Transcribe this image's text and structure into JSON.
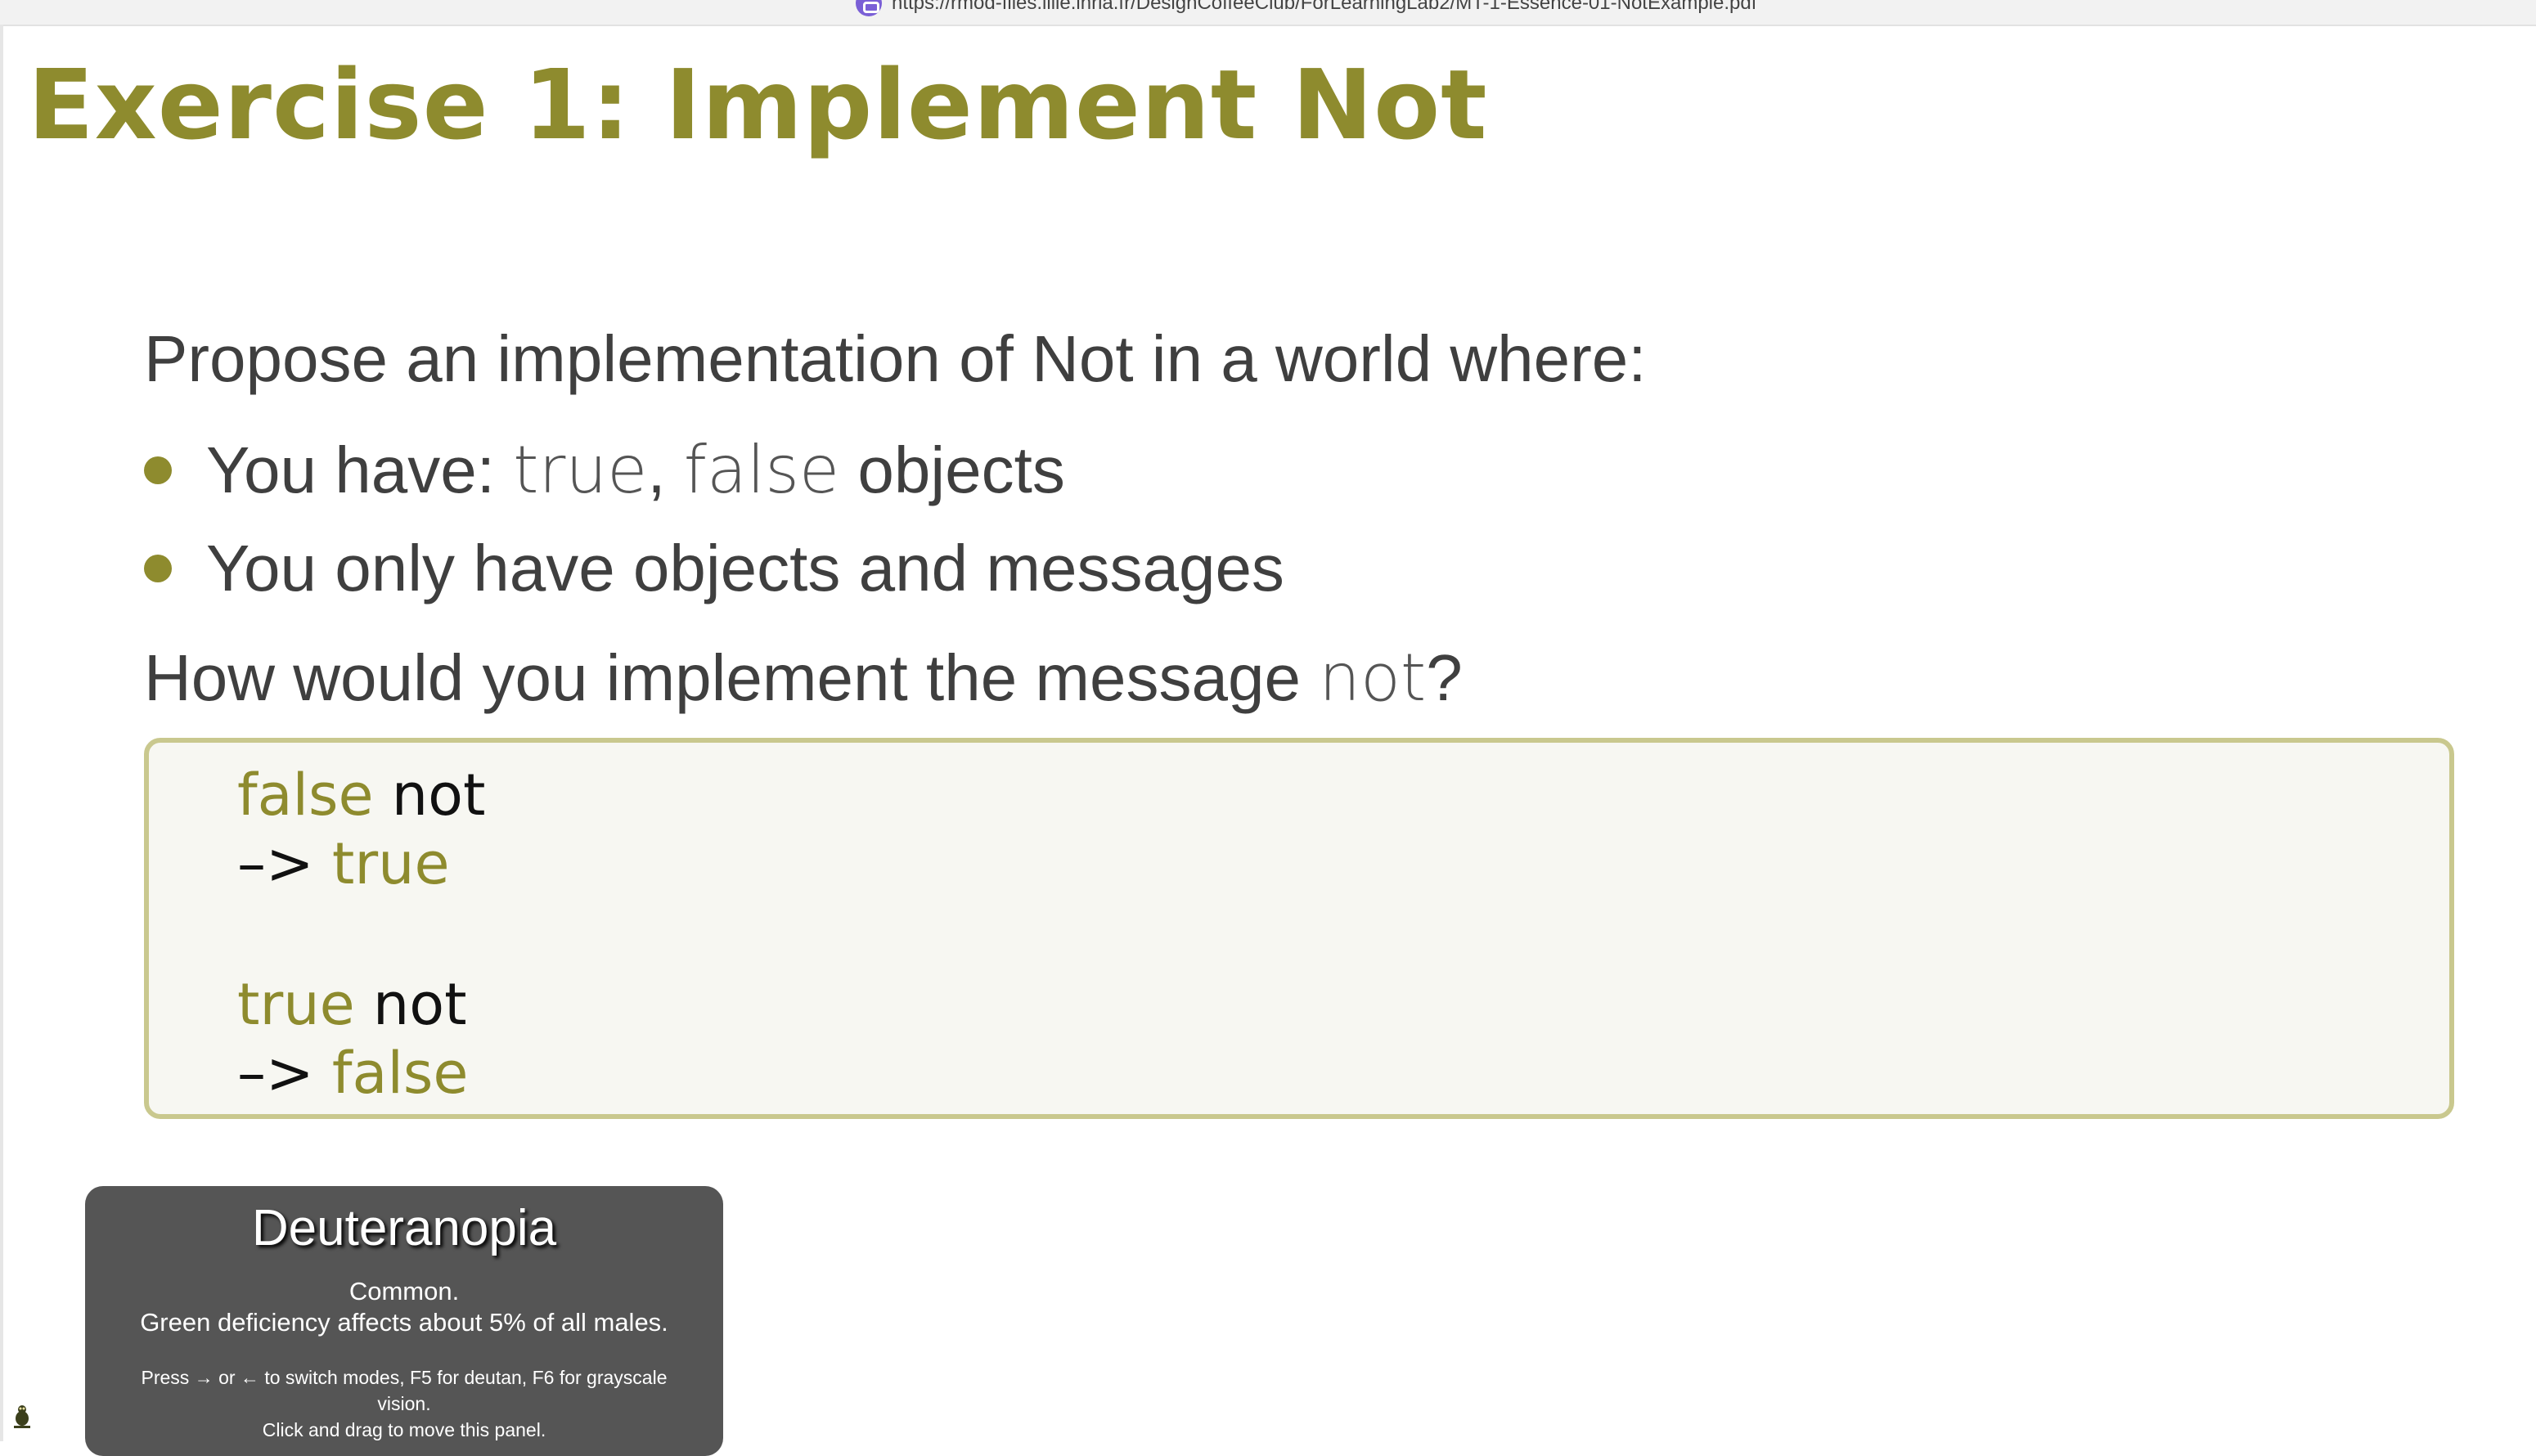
{
  "browser": {
    "url": "https://rmod-files.lille.inria.fr/DesignCoffeeClub/ForLearningLab2/MT-1-Essence-01-NotExample.pdf"
  },
  "slide": {
    "title": "Exercise 1: Implement Not",
    "prompt": "Propose an implementation of Not in a world where:",
    "bullet1": {
      "prefix": "You have: ",
      "code_true": "true",
      "comma": ", ",
      "code_false": "false",
      "suffix": " objects"
    },
    "bullet2": "You only have objects and messages",
    "question": {
      "prefix": "How would you implement the message ",
      "code": "not",
      "suffix": "?"
    },
    "code": {
      "line1_receiver": "false",
      "line1_message": " not",
      "line2_arrow": "–> ",
      "line2_result": "true",
      "line3_receiver": "true",
      "line3_message": " not",
      "line4_arrow": "–> ",
      "line4_result": "false"
    }
  },
  "overlay": {
    "title": "Deuteranopia",
    "line1": "Common.",
    "line2": "Green deficiency affects about 5% of all males.",
    "help": "Press → or ← to switch modes, F5 for deutan, F6 for grayscale vision.",
    "help2": "Click and drag to move this panel."
  },
  "colors": {
    "accent_olive": "#8e8b2e",
    "code_box_border": "#c9c88e",
    "panel_bg": "#555555"
  }
}
